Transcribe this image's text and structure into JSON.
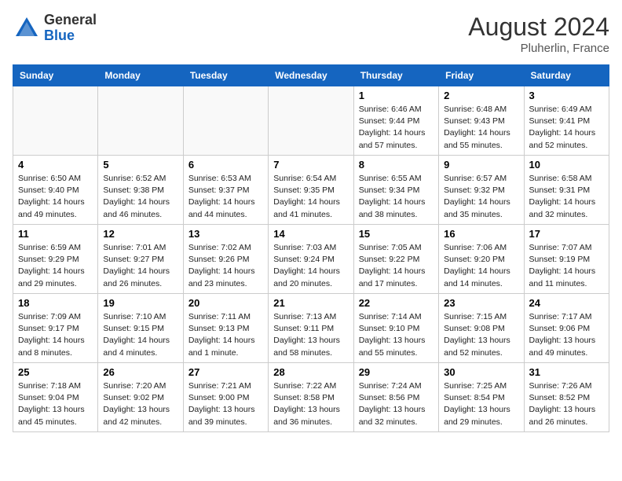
{
  "header": {
    "logo_general": "General",
    "logo_blue": "Blue",
    "month_year": "August 2024",
    "location": "Pluherlin, France"
  },
  "days_of_week": [
    "Sunday",
    "Monday",
    "Tuesday",
    "Wednesday",
    "Thursday",
    "Friday",
    "Saturday"
  ],
  "weeks": [
    [
      {
        "day": "",
        "info": ""
      },
      {
        "day": "",
        "info": ""
      },
      {
        "day": "",
        "info": ""
      },
      {
        "day": "",
        "info": ""
      },
      {
        "day": "1",
        "info": "Sunrise: 6:46 AM\nSunset: 9:44 PM\nDaylight: 14 hours\nand 57 minutes."
      },
      {
        "day": "2",
        "info": "Sunrise: 6:48 AM\nSunset: 9:43 PM\nDaylight: 14 hours\nand 55 minutes."
      },
      {
        "day": "3",
        "info": "Sunrise: 6:49 AM\nSunset: 9:41 PM\nDaylight: 14 hours\nand 52 minutes."
      }
    ],
    [
      {
        "day": "4",
        "info": "Sunrise: 6:50 AM\nSunset: 9:40 PM\nDaylight: 14 hours\nand 49 minutes."
      },
      {
        "day": "5",
        "info": "Sunrise: 6:52 AM\nSunset: 9:38 PM\nDaylight: 14 hours\nand 46 minutes."
      },
      {
        "day": "6",
        "info": "Sunrise: 6:53 AM\nSunset: 9:37 PM\nDaylight: 14 hours\nand 44 minutes."
      },
      {
        "day": "7",
        "info": "Sunrise: 6:54 AM\nSunset: 9:35 PM\nDaylight: 14 hours\nand 41 minutes."
      },
      {
        "day": "8",
        "info": "Sunrise: 6:55 AM\nSunset: 9:34 PM\nDaylight: 14 hours\nand 38 minutes."
      },
      {
        "day": "9",
        "info": "Sunrise: 6:57 AM\nSunset: 9:32 PM\nDaylight: 14 hours\nand 35 minutes."
      },
      {
        "day": "10",
        "info": "Sunrise: 6:58 AM\nSunset: 9:31 PM\nDaylight: 14 hours\nand 32 minutes."
      }
    ],
    [
      {
        "day": "11",
        "info": "Sunrise: 6:59 AM\nSunset: 9:29 PM\nDaylight: 14 hours\nand 29 minutes."
      },
      {
        "day": "12",
        "info": "Sunrise: 7:01 AM\nSunset: 9:27 PM\nDaylight: 14 hours\nand 26 minutes."
      },
      {
        "day": "13",
        "info": "Sunrise: 7:02 AM\nSunset: 9:26 PM\nDaylight: 14 hours\nand 23 minutes."
      },
      {
        "day": "14",
        "info": "Sunrise: 7:03 AM\nSunset: 9:24 PM\nDaylight: 14 hours\nand 20 minutes."
      },
      {
        "day": "15",
        "info": "Sunrise: 7:05 AM\nSunset: 9:22 PM\nDaylight: 14 hours\nand 17 minutes."
      },
      {
        "day": "16",
        "info": "Sunrise: 7:06 AM\nSunset: 9:20 PM\nDaylight: 14 hours\nand 14 minutes."
      },
      {
        "day": "17",
        "info": "Sunrise: 7:07 AM\nSunset: 9:19 PM\nDaylight: 14 hours\nand 11 minutes."
      }
    ],
    [
      {
        "day": "18",
        "info": "Sunrise: 7:09 AM\nSunset: 9:17 PM\nDaylight: 14 hours\nand 8 minutes."
      },
      {
        "day": "19",
        "info": "Sunrise: 7:10 AM\nSunset: 9:15 PM\nDaylight: 14 hours\nand 4 minutes."
      },
      {
        "day": "20",
        "info": "Sunrise: 7:11 AM\nSunset: 9:13 PM\nDaylight: 14 hours\nand 1 minute."
      },
      {
        "day": "21",
        "info": "Sunrise: 7:13 AM\nSunset: 9:11 PM\nDaylight: 13 hours\nand 58 minutes."
      },
      {
        "day": "22",
        "info": "Sunrise: 7:14 AM\nSunset: 9:10 PM\nDaylight: 13 hours\nand 55 minutes."
      },
      {
        "day": "23",
        "info": "Sunrise: 7:15 AM\nSunset: 9:08 PM\nDaylight: 13 hours\nand 52 minutes."
      },
      {
        "day": "24",
        "info": "Sunrise: 7:17 AM\nSunset: 9:06 PM\nDaylight: 13 hours\nand 49 minutes."
      }
    ],
    [
      {
        "day": "25",
        "info": "Sunrise: 7:18 AM\nSunset: 9:04 PM\nDaylight: 13 hours\nand 45 minutes."
      },
      {
        "day": "26",
        "info": "Sunrise: 7:20 AM\nSunset: 9:02 PM\nDaylight: 13 hours\nand 42 minutes."
      },
      {
        "day": "27",
        "info": "Sunrise: 7:21 AM\nSunset: 9:00 PM\nDaylight: 13 hours\nand 39 minutes."
      },
      {
        "day": "28",
        "info": "Sunrise: 7:22 AM\nSunset: 8:58 PM\nDaylight: 13 hours\nand 36 minutes."
      },
      {
        "day": "29",
        "info": "Sunrise: 7:24 AM\nSunset: 8:56 PM\nDaylight: 13 hours\nand 32 minutes."
      },
      {
        "day": "30",
        "info": "Sunrise: 7:25 AM\nSunset: 8:54 PM\nDaylight: 13 hours\nand 29 minutes."
      },
      {
        "day": "31",
        "info": "Sunrise: 7:26 AM\nSunset: 8:52 PM\nDaylight: 13 hours\nand 26 minutes."
      }
    ]
  ]
}
